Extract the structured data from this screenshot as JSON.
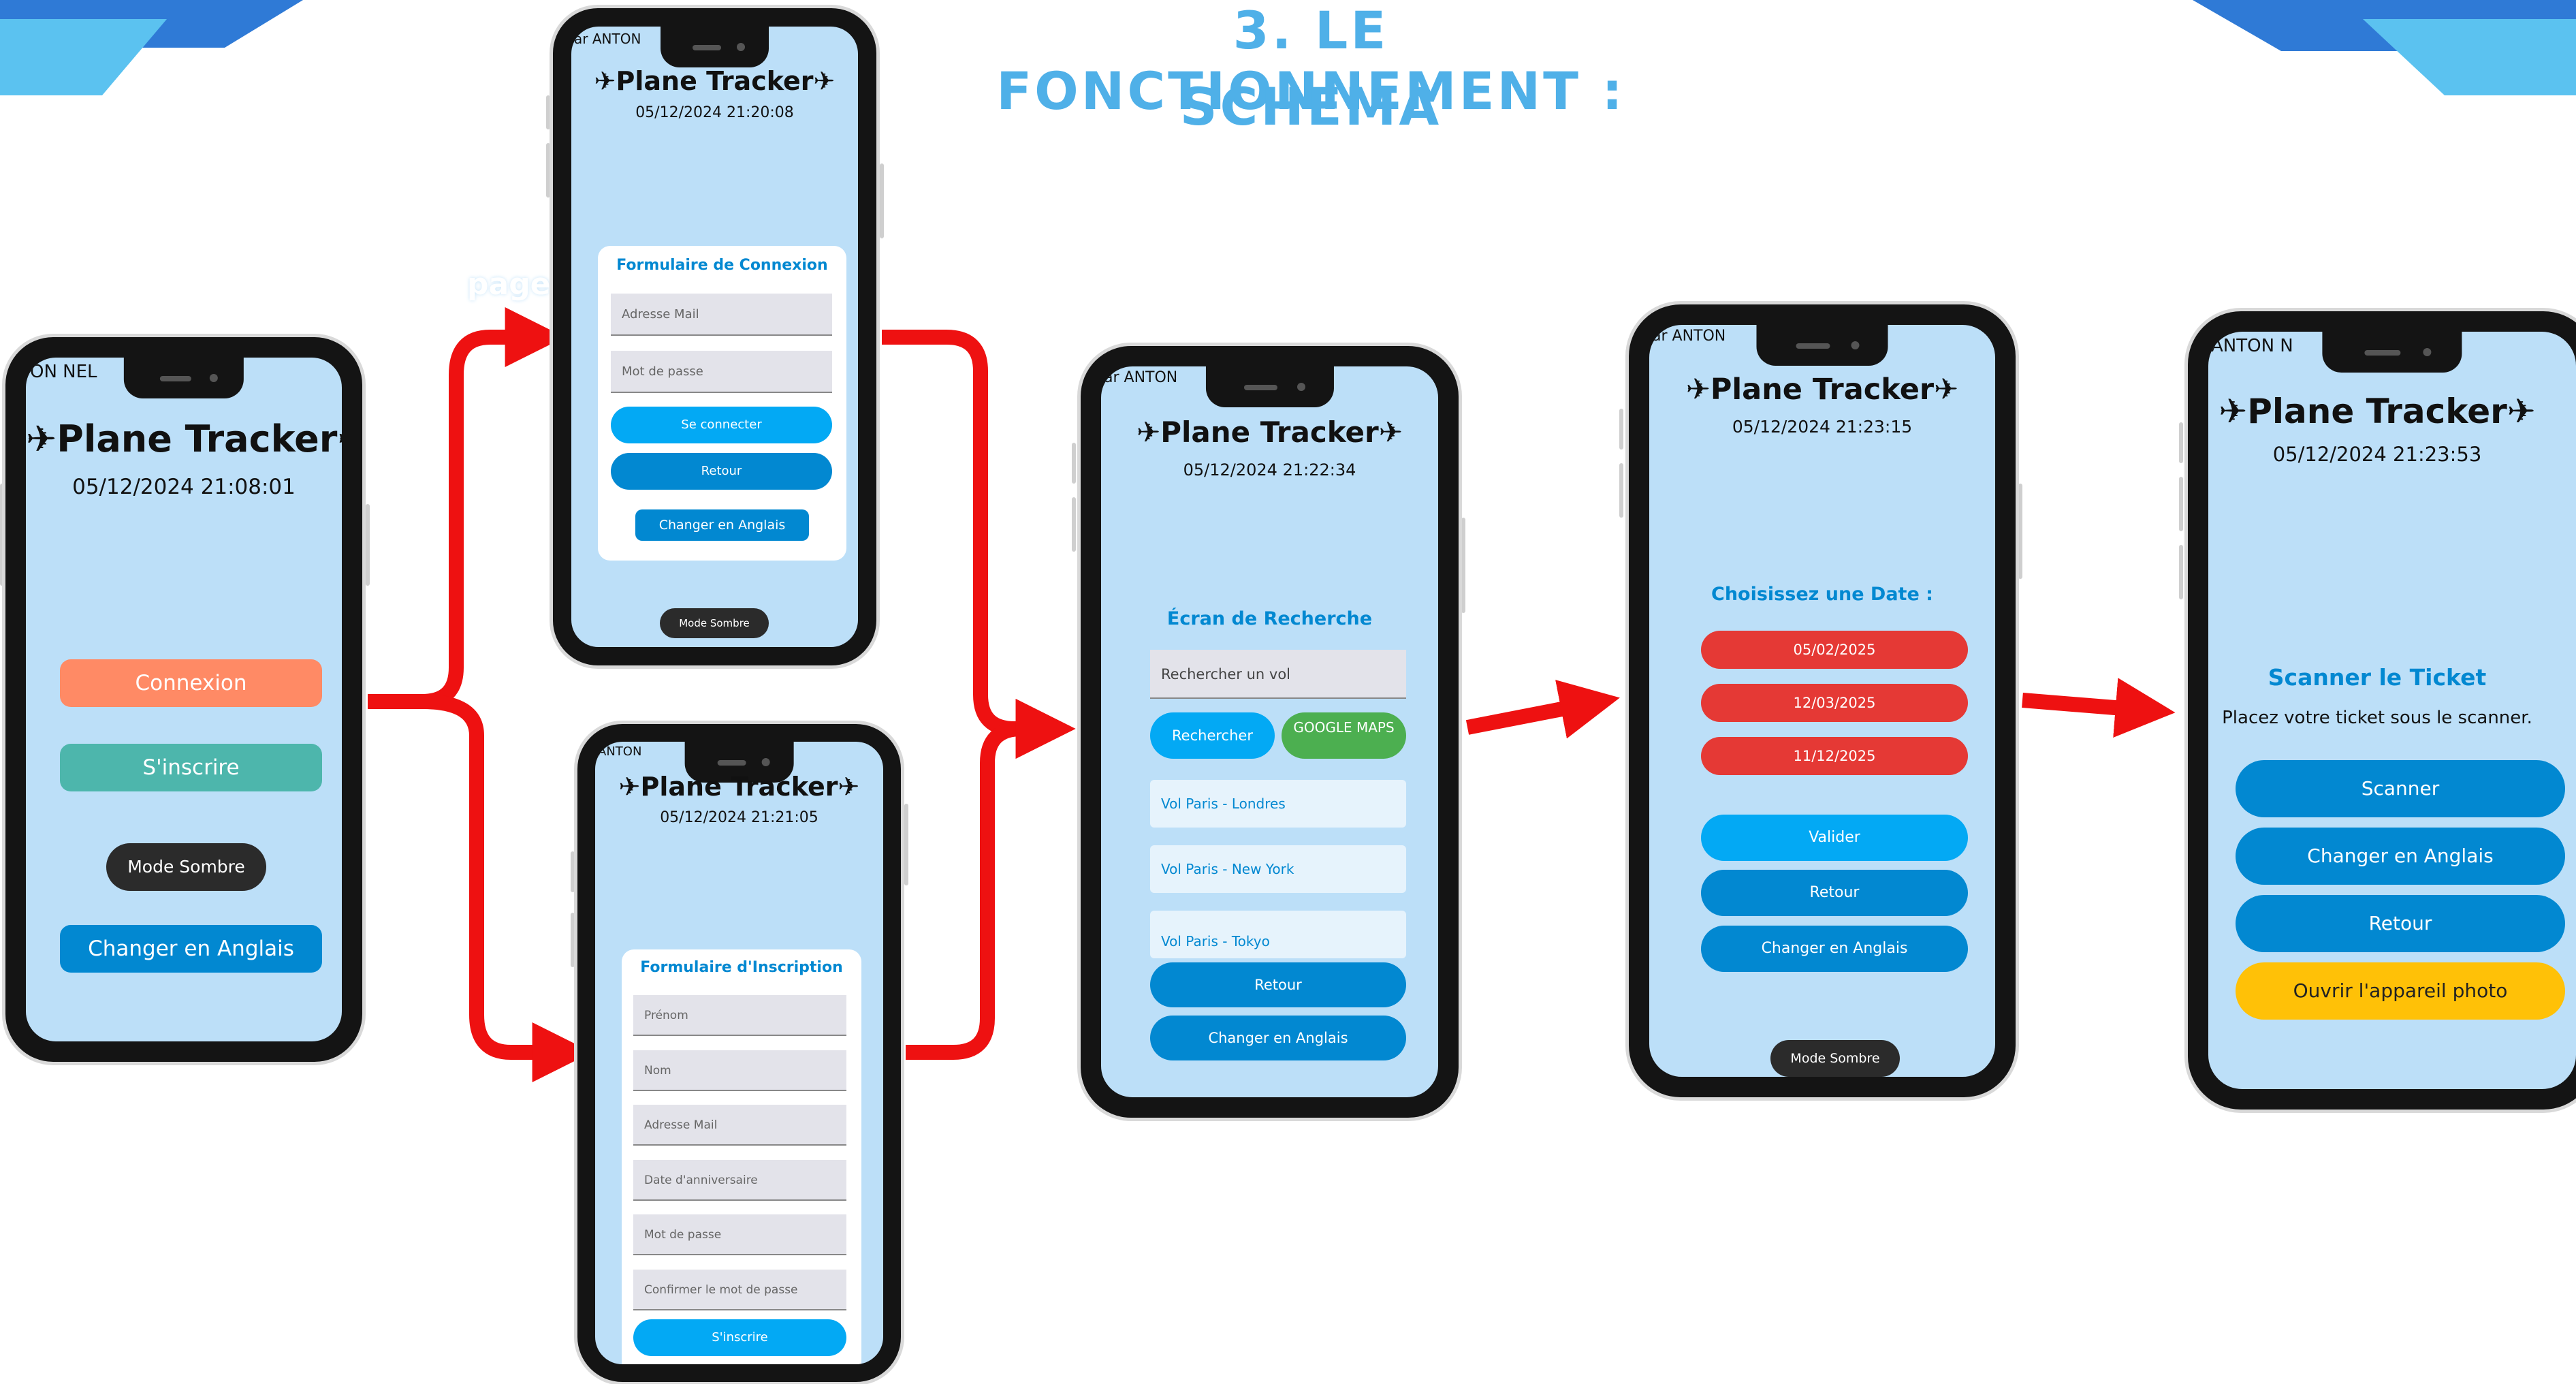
{
  "title": {
    "line1": "3. LE FONCTIONNEMENT :",
    "line2": "SCHEMA"
  },
  "colors": {
    "title": "#4fb0e8",
    "arrow": "#ee1111",
    "screen_bg": "#bcdff8",
    "blue_btn": "#0288d1",
    "light_blue_btn": "#03a9f4",
    "red_btn": "#e53935",
    "yellow_btn": "#ffc107",
    "green_btn": "#4caf50",
    "orange_btn": "#ff8a65",
    "teal_btn": "#4db6ac"
  },
  "annotation": "page d'acceuil",
  "home": {
    "status_text": "ON NEL",
    "app_title": "✈Plane Tracker✈",
    "datetime": "05/12/2024 21:08:01",
    "login_btn": "Connexion",
    "signup_btn": "S'inscrire",
    "dark_mode_btn": "Mode Sombre",
    "english_btn": "Changer en Anglais"
  },
  "login": {
    "status_text": "ar ANTON",
    "app_title": "✈Plane Tracker✈",
    "datetime": "05/12/2024 21:20:08",
    "form_title": "Formulaire de Connexion",
    "email_placeholder": "Adresse Mail",
    "password_placeholder": "Mot de passe",
    "connect_btn": "Se connecter",
    "back_btn": "Retour",
    "english_btn": "Changer en Anglais",
    "dark_mode_btn": "Mode Sombre"
  },
  "signup": {
    "status_text": "ANTON",
    "app_title": "✈Plane Tracker✈",
    "datetime": "05/12/2024 21:21:05",
    "form_title": "Formulaire d'Inscription",
    "fields": [
      "Prénom",
      "Nom",
      "Adresse Mail",
      "Date d'anniversaire",
      "Mot de passe",
      "Confirmer le mot de passe"
    ],
    "submit_btn": "S'inscrire"
  },
  "search": {
    "status_text": "ar ANTON",
    "app_title": "✈Plane Tracker✈",
    "datetime": "05/12/2024 21:22:34",
    "screen_title": "Écran de Recherche",
    "search_placeholder": "Rechercher un vol",
    "search_btn": "Rechercher",
    "maps_btn": "GOOGLE MAPS",
    "flights": [
      "Vol Paris - Londres",
      "Vol Paris - New York",
      "Vol Paris - Tokyo"
    ],
    "back_btn": "Retour",
    "english_btn": "Changer en Anglais"
  },
  "dates": {
    "status_text": "ar ANTON",
    "app_title": "✈Plane Tracker✈",
    "datetime": "05/12/2024 21:23:15",
    "screen_title": "Choisissez une Date :",
    "dates": [
      "05/02/2025",
      "12/03/2025",
      "11/12/2025"
    ],
    "validate_btn": "Valider",
    "back_btn": "Retour",
    "english_btn": "Changer en Anglais",
    "dark_mode_btn": "Mode Sombre"
  },
  "scanner": {
    "status_text": "ANTON N",
    "app_title": "✈Plane Tracker✈",
    "datetime": "05/12/2024 21:23:53",
    "screen_title": "Scanner le Ticket",
    "instruction": "Placez votre ticket sous le scanner.",
    "scan_btn": "Scanner",
    "english_btn": "Changer en Anglais",
    "back_btn": "Retour",
    "camera_btn": "Ouvrir l'appareil photo"
  }
}
